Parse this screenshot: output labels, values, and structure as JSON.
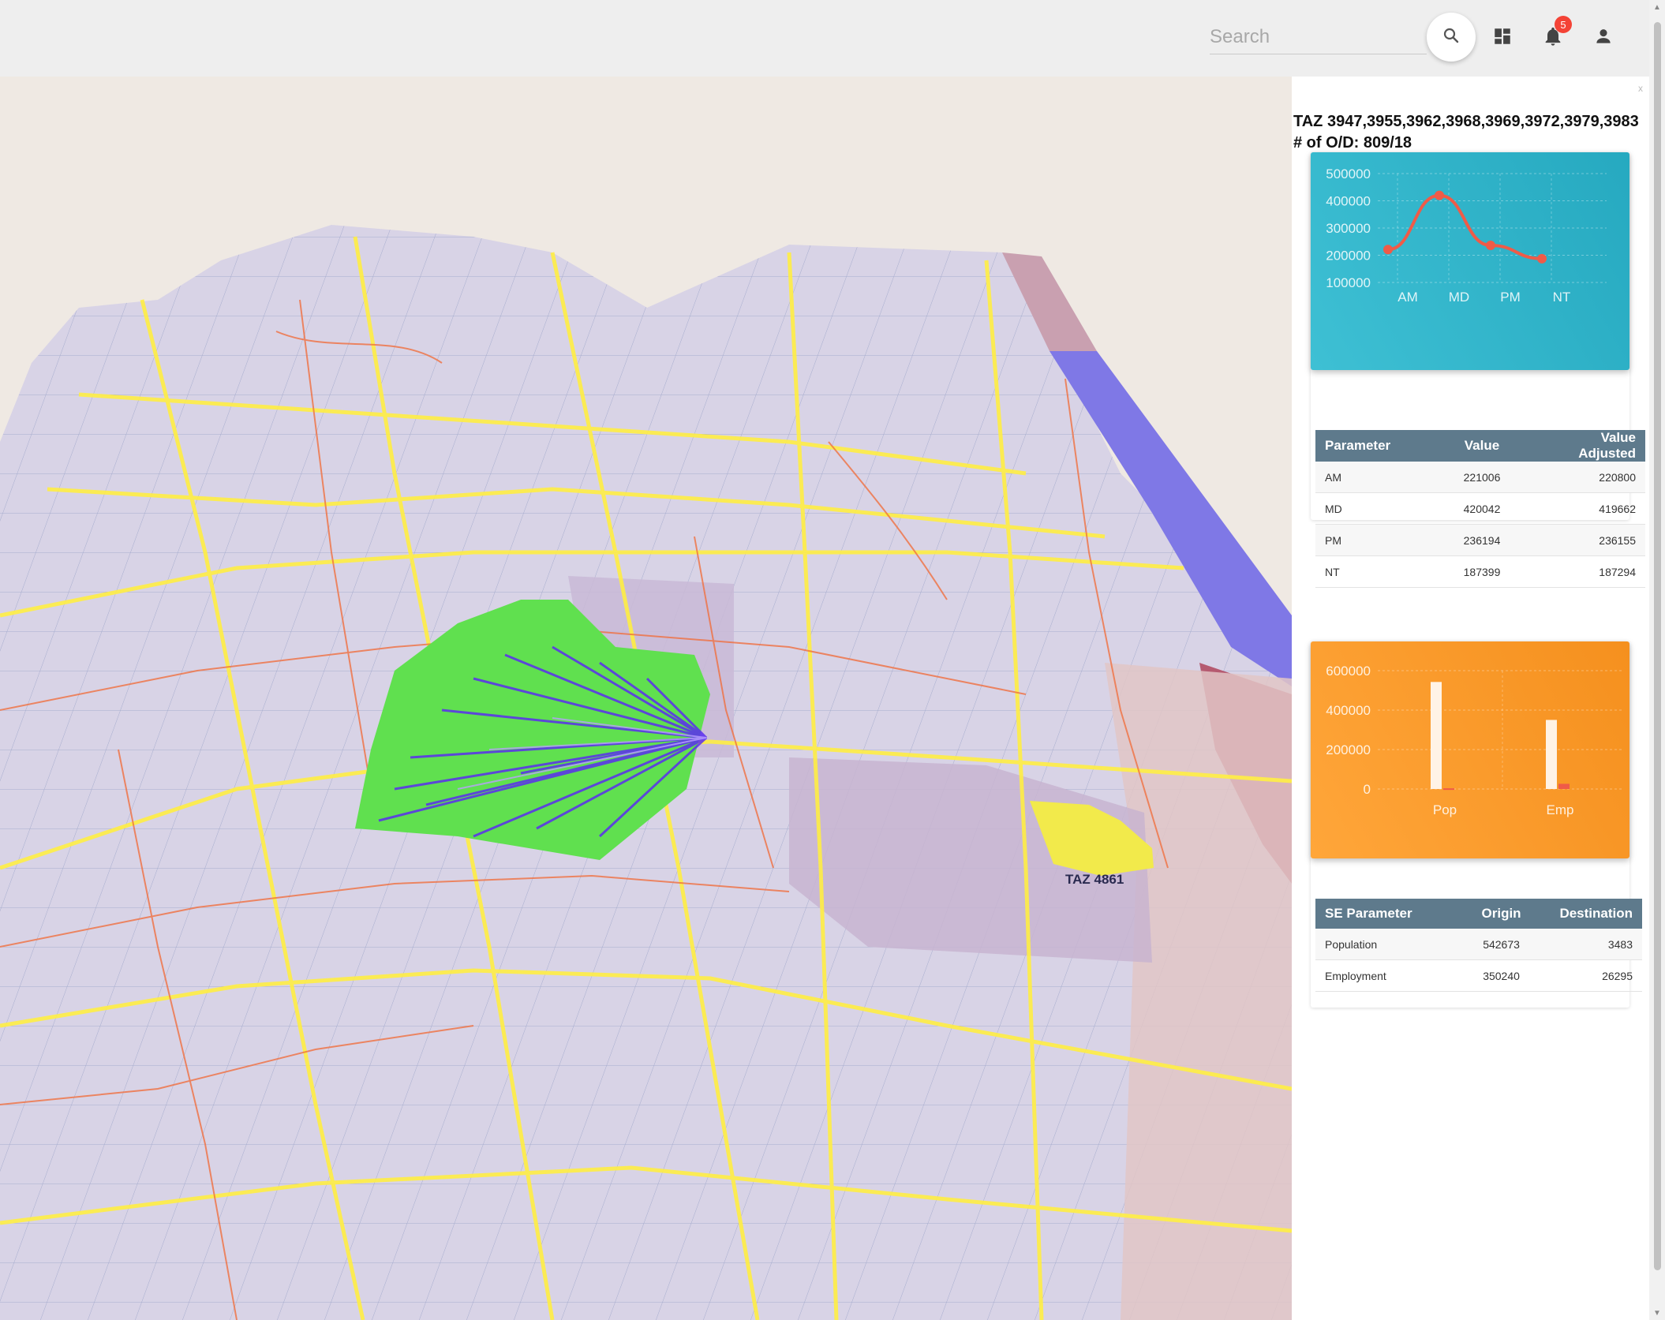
{
  "search": {
    "placeholder": "Search"
  },
  "toolbar": {
    "notification_count": "5"
  },
  "icons": [
    "search-icon",
    "dashboard-icon",
    "bell-icon",
    "person-icon",
    "close-icon"
  ],
  "map": {
    "taz_label": "TAZ 4861"
  },
  "panel": {
    "title": "TAZ 3947,3955,3962,3968,3969,3972,3979,3983",
    "od_count": "# of O/D: 809/18",
    "close_label": "x"
  },
  "period_table": {
    "headers": [
      "Parameter",
      "Value",
      "Value Adjusted"
    ],
    "rows": [
      {
        "param": "AM",
        "value": "221006",
        "adjusted": "220800"
      },
      {
        "param": "MD",
        "value": "420042",
        "adjusted": "419662"
      },
      {
        "param": "PM",
        "value": "236194",
        "adjusted": "236155"
      },
      {
        "param": "NT",
        "value": "187399",
        "adjusted": "187294"
      }
    ]
  },
  "se_table": {
    "headers": [
      "SE Parameter",
      "Origin",
      "Destination"
    ],
    "rows": [
      {
        "param": "Population",
        "origin": "542673",
        "destination": "3483"
      },
      {
        "param": "Employment",
        "origin": "350240",
        "destination": "26295"
      }
    ]
  },
  "colors": {
    "teal_card": "#2fb3c8",
    "orange_card": "#fa9a2a",
    "line": "#ef5b48",
    "taz_fill": "#60e04f",
    "flow": "#5b2df0"
  },
  "chart_data": [
    {
      "type": "line",
      "categories": [
        "AM",
        "MD",
        "PM",
        "NT"
      ],
      "series": [
        {
          "values": [
            221006,
            420042,
            236194,
            187399
          ]
        }
      ],
      "yticks": [
        100000,
        200000,
        300000,
        400000,
        500000
      ],
      "ylim": [
        100000,
        500000
      ],
      "grid": true
    },
    {
      "type": "bar",
      "categories": [
        "Pop",
        "Emp"
      ],
      "series": [
        {
          "values": [
            542673,
            350240
          ]
        },
        {
          "values": [
            3483,
            26295
          ]
        }
      ],
      "yticks": [
        0,
        200000,
        400000,
        600000
      ],
      "ylim": [
        0,
        600000
      ],
      "grid": true
    }
  ]
}
